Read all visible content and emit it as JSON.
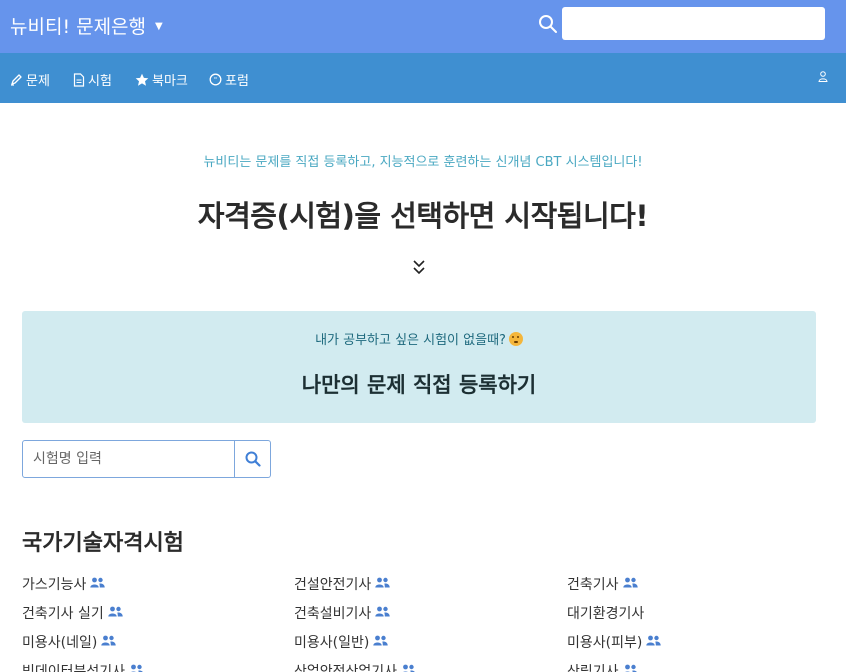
{
  "header": {
    "brand": "뉴비티! 문제은행",
    "search_value": "",
    "search_placeholder": ""
  },
  "nav": {
    "items": [
      {
        "label": "문제",
        "icon": "pencil-icon"
      },
      {
        "label": "시험",
        "icon": "document-icon"
      },
      {
        "label": "북마크",
        "icon": "star-icon"
      },
      {
        "label": "포럼",
        "icon": "chat-icon"
      }
    ],
    "account_icon": "user-icon"
  },
  "hero": {
    "tagline": "뉴비티는 문제를 직접 등록하고, 지능적으로 훈련하는 신개념 CBT 시스템입니다!",
    "headline": "자격증(시험)을 선택하면 시작됩니다!"
  },
  "callout": {
    "question": "내가 공부하고 싶은 시험이 없을때?",
    "cta": "나만의 문제 직접 등록하기"
  },
  "exam_search": {
    "placeholder": "시험명 입력",
    "value": ""
  },
  "section": {
    "title": "국가기술자격시험",
    "exams": [
      {
        "name": "가스기능사",
        "community": true
      },
      {
        "name": "건설안전기사",
        "community": true
      },
      {
        "name": "건축기사",
        "community": true
      },
      {
        "name": "건축기사 실기",
        "community": true
      },
      {
        "name": "건축설비기사",
        "community": true
      },
      {
        "name": "대기환경기사",
        "community": false
      },
      {
        "name": "미용사(네일)",
        "community": true
      },
      {
        "name": "미용사(일반)",
        "community": true
      },
      {
        "name": "미용사(피부)",
        "community": true
      },
      {
        "name": "빅데이터분석기사",
        "community": true
      },
      {
        "name": "산업안전산업기사",
        "community": true
      },
      {
        "name": "산림기사",
        "community": true
      }
    ]
  },
  "colors": {
    "topbar": "#6694ec",
    "navbar": "#3f8fd1",
    "callout_bg": "#d2ebf0",
    "tagline": "#4aa8c2",
    "users_icon": "#4a7fcf"
  }
}
